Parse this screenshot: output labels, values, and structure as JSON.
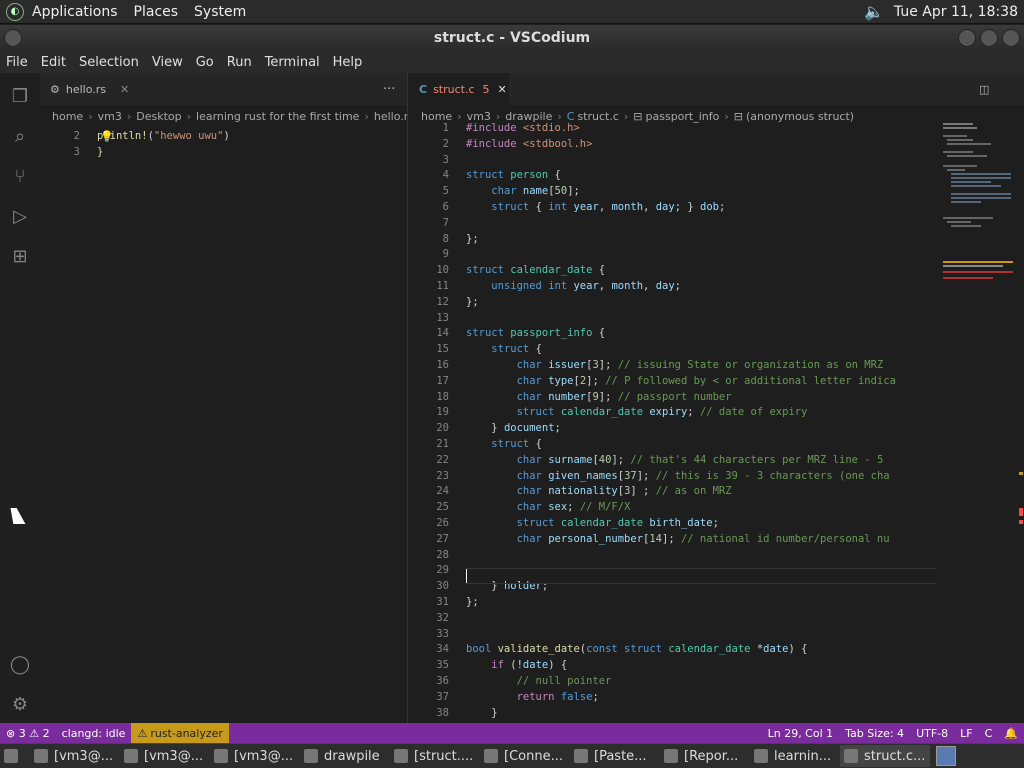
{
  "panel": {
    "menus": [
      "Applications",
      "Places",
      "System"
    ],
    "clock": "Tue Apr 11, 18:38"
  },
  "window": {
    "title": "struct.c - VSCodium"
  },
  "menubar": [
    "File",
    "Edit",
    "Selection",
    "View",
    "Go",
    "Run",
    "Terminal",
    "Help"
  ],
  "left_editor": {
    "tab": {
      "label": "hello.rs"
    },
    "more": "···",
    "breadcrumbs": [
      "home",
      "vm3",
      "Desktop",
      "learning rust for the first time",
      "hello.rs"
    ],
    "lines": [
      {
        "n": "2",
        "tokens": [
          {
            "c": "f",
            "t": "println!"
          },
          {
            "c": "p",
            "t": "("
          },
          {
            "c": "s",
            "t": "\"hewwo uwu\""
          },
          {
            "c": "p",
            "t": ")"
          }
        ]
      },
      {
        "n": "3",
        "tokens": [
          {
            "c": "f",
            "t": "}"
          }
        ]
      }
    ]
  },
  "right_editor": {
    "tab": {
      "label": "struct.c",
      "problems": "5"
    },
    "breadcrumbs": [
      "home",
      "vm3",
      "drawpile",
      "struct.c",
      "passport_info",
      "(anonymous struct)"
    ],
    "lines": [
      {
        "n": "1",
        "tokens": [
          {
            "c": "pr",
            "t": "#include "
          },
          {
            "c": "s",
            "t": "<stdio.h>"
          }
        ]
      },
      {
        "n": "2",
        "tokens": [
          {
            "c": "pr",
            "t": "#include "
          },
          {
            "c": "s",
            "t": "<stdbool.h>"
          }
        ]
      },
      {
        "n": "3",
        "tokens": []
      },
      {
        "n": "4",
        "tokens": [
          {
            "c": "k",
            "t": "struct "
          },
          {
            "c": "t",
            "t": "person"
          },
          {
            "c": "p",
            "t": " {"
          }
        ]
      },
      {
        "n": "5",
        "tokens": [
          {
            "c": "p",
            "t": "    "
          },
          {
            "c": "k",
            "t": "char "
          },
          {
            "c": "v",
            "t": "name"
          },
          {
            "c": "p",
            "t": "["
          },
          {
            "c": "n",
            "t": "50"
          },
          {
            "c": "p",
            "t": "];"
          }
        ]
      },
      {
        "n": "6",
        "tokens": [
          {
            "c": "p",
            "t": "    "
          },
          {
            "c": "k",
            "t": "struct "
          },
          {
            "c": "p",
            "t": "{ "
          },
          {
            "c": "k",
            "t": "int "
          },
          {
            "c": "v",
            "t": "year"
          },
          {
            "c": "p",
            "t": ", "
          },
          {
            "c": "v",
            "t": "month"
          },
          {
            "c": "p",
            "t": ", "
          },
          {
            "c": "v",
            "t": "day"
          },
          {
            "c": "p",
            "t": "; } "
          },
          {
            "c": "v",
            "t": "dob"
          },
          {
            "c": "p",
            "t": ";"
          }
        ]
      },
      {
        "n": "7",
        "tokens": []
      },
      {
        "n": "8",
        "tokens": [
          {
            "c": "p",
            "t": "};"
          }
        ]
      },
      {
        "n": "9",
        "tokens": []
      },
      {
        "n": "10",
        "tokens": [
          {
            "c": "k",
            "t": "struct "
          },
          {
            "c": "t",
            "t": "calendar_date"
          },
          {
            "c": "p",
            "t": " {"
          }
        ]
      },
      {
        "n": "11",
        "tokens": [
          {
            "c": "p",
            "t": "    "
          },
          {
            "c": "k",
            "t": "unsigned int "
          },
          {
            "c": "v",
            "t": "year"
          },
          {
            "c": "p",
            "t": ", "
          },
          {
            "c": "v",
            "t": "month"
          },
          {
            "c": "p",
            "t": ", "
          },
          {
            "c": "v",
            "t": "day"
          },
          {
            "c": "p",
            "t": ";"
          }
        ]
      },
      {
        "n": "12",
        "tokens": [
          {
            "c": "p",
            "t": "};"
          }
        ]
      },
      {
        "n": "13",
        "tokens": []
      },
      {
        "n": "14",
        "tokens": [
          {
            "c": "k",
            "t": "struct "
          },
          {
            "c": "t",
            "t": "passport_info"
          },
          {
            "c": "p",
            "t": " {"
          }
        ]
      },
      {
        "n": "15",
        "tokens": [
          {
            "c": "p",
            "t": "    "
          },
          {
            "c": "k",
            "t": "struct "
          },
          {
            "c": "p",
            "t": "{"
          }
        ]
      },
      {
        "n": "16",
        "tokens": [
          {
            "c": "p",
            "t": "        "
          },
          {
            "c": "k",
            "t": "char "
          },
          {
            "c": "v",
            "t": "issuer"
          },
          {
            "c": "p",
            "t": "["
          },
          {
            "c": "n",
            "t": "3"
          },
          {
            "c": "p",
            "t": "]; "
          },
          {
            "c": "c",
            "t": "// issuing State or organization as on MRZ"
          }
        ]
      },
      {
        "n": "17",
        "tokens": [
          {
            "c": "p",
            "t": "        "
          },
          {
            "c": "k",
            "t": "char "
          },
          {
            "c": "v",
            "t": "type"
          },
          {
            "c": "p",
            "t": "["
          },
          {
            "c": "n",
            "t": "2"
          },
          {
            "c": "p",
            "t": "]; "
          },
          {
            "c": "c",
            "t": "// P followed by < or additional letter indica"
          }
        ]
      },
      {
        "n": "18",
        "tokens": [
          {
            "c": "p",
            "t": "        "
          },
          {
            "c": "k",
            "t": "char "
          },
          {
            "c": "v",
            "t": "number"
          },
          {
            "c": "p",
            "t": "["
          },
          {
            "c": "n",
            "t": "9"
          },
          {
            "c": "p",
            "t": "]; "
          },
          {
            "c": "c",
            "t": "// passport number"
          }
        ]
      },
      {
        "n": "19",
        "tokens": [
          {
            "c": "p",
            "t": "        "
          },
          {
            "c": "k",
            "t": "struct "
          },
          {
            "c": "t",
            "t": "calendar_date "
          },
          {
            "c": "v",
            "t": "expiry"
          },
          {
            "c": "p",
            "t": "; "
          },
          {
            "c": "c",
            "t": "// date of expiry"
          }
        ]
      },
      {
        "n": "20",
        "tokens": [
          {
            "c": "p",
            "t": "    } "
          },
          {
            "c": "v",
            "t": "document"
          },
          {
            "c": "p",
            "t": ";"
          }
        ]
      },
      {
        "n": "21",
        "tokens": [
          {
            "c": "p",
            "t": "    "
          },
          {
            "c": "k",
            "t": "struct "
          },
          {
            "c": "p",
            "t": "{"
          }
        ]
      },
      {
        "n": "22",
        "tokens": [
          {
            "c": "p",
            "t": "        "
          },
          {
            "c": "k",
            "t": "char "
          },
          {
            "c": "v",
            "t": "surname"
          },
          {
            "c": "p",
            "t": "["
          },
          {
            "c": "n",
            "t": "40"
          },
          {
            "c": "p",
            "t": "]; "
          },
          {
            "c": "c",
            "t": "// that's 44 characters per MRZ line - 5"
          }
        ]
      },
      {
        "n": "23",
        "tokens": [
          {
            "c": "p",
            "t": "        "
          },
          {
            "c": "k",
            "t": "char "
          },
          {
            "c": "v",
            "t": "given_names"
          },
          {
            "c": "p",
            "t": "["
          },
          {
            "c": "n",
            "t": "37"
          },
          {
            "c": "p",
            "t": "]; "
          },
          {
            "c": "c",
            "t": "// this is 39 - 3 characters (one cha"
          }
        ]
      },
      {
        "n": "24",
        "tokens": [
          {
            "c": "p",
            "t": "        "
          },
          {
            "c": "k",
            "t": "char "
          },
          {
            "c": "v",
            "t": "nationality"
          },
          {
            "c": "p",
            "t": "["
          },
          {
            "c": "n",
            "t": "3"
          },
          {
            "c": "p",
            "t": "] ; "
          },
          {
            "c": "c",
            "t": "// as on MRZ"
          }
        ]
      },
      {
        "n": "25",
        "tokens": [
          {
            "c": "p",
            "t": "        "
          },
          {
            "c": "k",
            "t": "char "
          },
          {
            "c": "v",
            "t": "sex"
          },
          {
            "c": "p",
            "t": "; "
          },
          {
            "c": "c",
            "t": "// M/F/X"
          }
        ]
      },
      {
        "n": "26",
        "tokens": [
          {
            "c": "p",
            "t": "        "
          },
          {
            "c": "k",
            "t": "struct "
          },
          {
            "c": "t",
            "t": "calendar_date "
          },
          {
            "c": "v",
            "t": "birth_date"
          },
          {
            "c": "p",
            "t": ";"
          }
        ]
      },
      {
        "n": "27",
        "tokens": [
          {
            "c": "p",
            "t": "        "
          },
          {
            "c": "k",
            "t": "char "
          },
          {
            "c": "v",
            "t": "personal_number"
          },
          {
            "c": "p",
            "t": "["
          },
          {
            "c": "n",
            "t": "14"
          },
          {
            "c": "p",
            "t": "]; "
          },
          {
            "c": "c",
            "t": "// national id number/personal nu"
          }
        ]
      },
      {
        "n": "28",
        "tokens": []
      },
      {
        "n": "29",
        "tokens": []
      },
      {
        "n": "30",
        "tokens": [
          {
            "c": "p",
            "t": "    } "
          },
          {
            "c": "v",
            "t": "holder"
          },
          {
            "c": "p",
            "t": ";"
          }
        ]
      },
      {
        "n": "31",
        "tokens": [
          {
            "c": "p",
            "t": "};"
          }
        ]
      },
      {
        "n": "32",
        "tokens": []
      },
      {
        "n": "33",
        "tokens": []
      },
      {
        "n": "34",
        "tokens": [
          {
            "c": "k",
            "t": "bool "
          },
          {
            "c": "f",
            "t": "validate_date"
          },
          {
            "c": "p",
            "t": "("
          },
          {
            "c": "k",
            "t": "const struct "
          },
          {
            "c": "t",
            "t": "calendar_date "
          },
          {
            "c": "p",
            "t": "*"
          },
          {
            "c": "v",
            "t": "date"
          },
          {
            "c": "p",
            "t": ") {"
          }
        ]
      },
      {
        "n": "35",
        "tokens": [
          {
            "c": "p",
            "t": "    "
          },
          {
            "c": "pr",
            "t": "if "
          },
          {
            "c": "p",
            "t": "(!"
          },
          {
            "c": "v",
            "t": "date"
          },
          {
            "c": "p",
            "t": ") {"
          }
        ]
      },
      {
        "n": "36",
        "tokens": [
          {
            "c": "p",
            "t": "        "
          },
          {
            "c": "c",
            "t": "// null pointer"
          }
        ]
      },
      {
        "n": "37",
        "tokens": [
          {
            "c": "p",
            "t": "        "
          },
          {
            "c": "pr",
            "t": "return "
          },
          {
            "c": "k",
            "t": "false"
          },
          {
            "c": "p",
            "t": ";"
          }
        ]
      },
      {
        "n": "38",
        "tokens": [
          {
            "c": "p",
            "t": "    }"
          }
        ]
      }
    ]
  },
  "status": {
    "errors": "3",
    "warnings": "2",
    "clangd": "clangd: idle",
    "rust_analyzer": "rust-analyzer",
    "position": "Ln 29, Col 1",
    "tab_size": "Tab Size: 4",
    "encoding": "UTF-8",
    "eol": "LF",
    "language": "C",
    "accent": "#7a2b9e"
  },
  "taskbar": [
    {
      "label": "[vm3@..."
    },
    {
      "label": "[vm3@..."
    },
    {
      "label": "[vm3@..."
    },
    {
      "label": "drawpile"
    },
    {
      "label": "[struct...."
    },
    {
      "label": "[Conne..."
    },
    {
      "label": "[Paste..."
    },
    {
      "label": "[Repor..."
    },
    {
      "label": "learnin..."
    },
    {
      "label": "struct.c..."
    }
  ]
}
